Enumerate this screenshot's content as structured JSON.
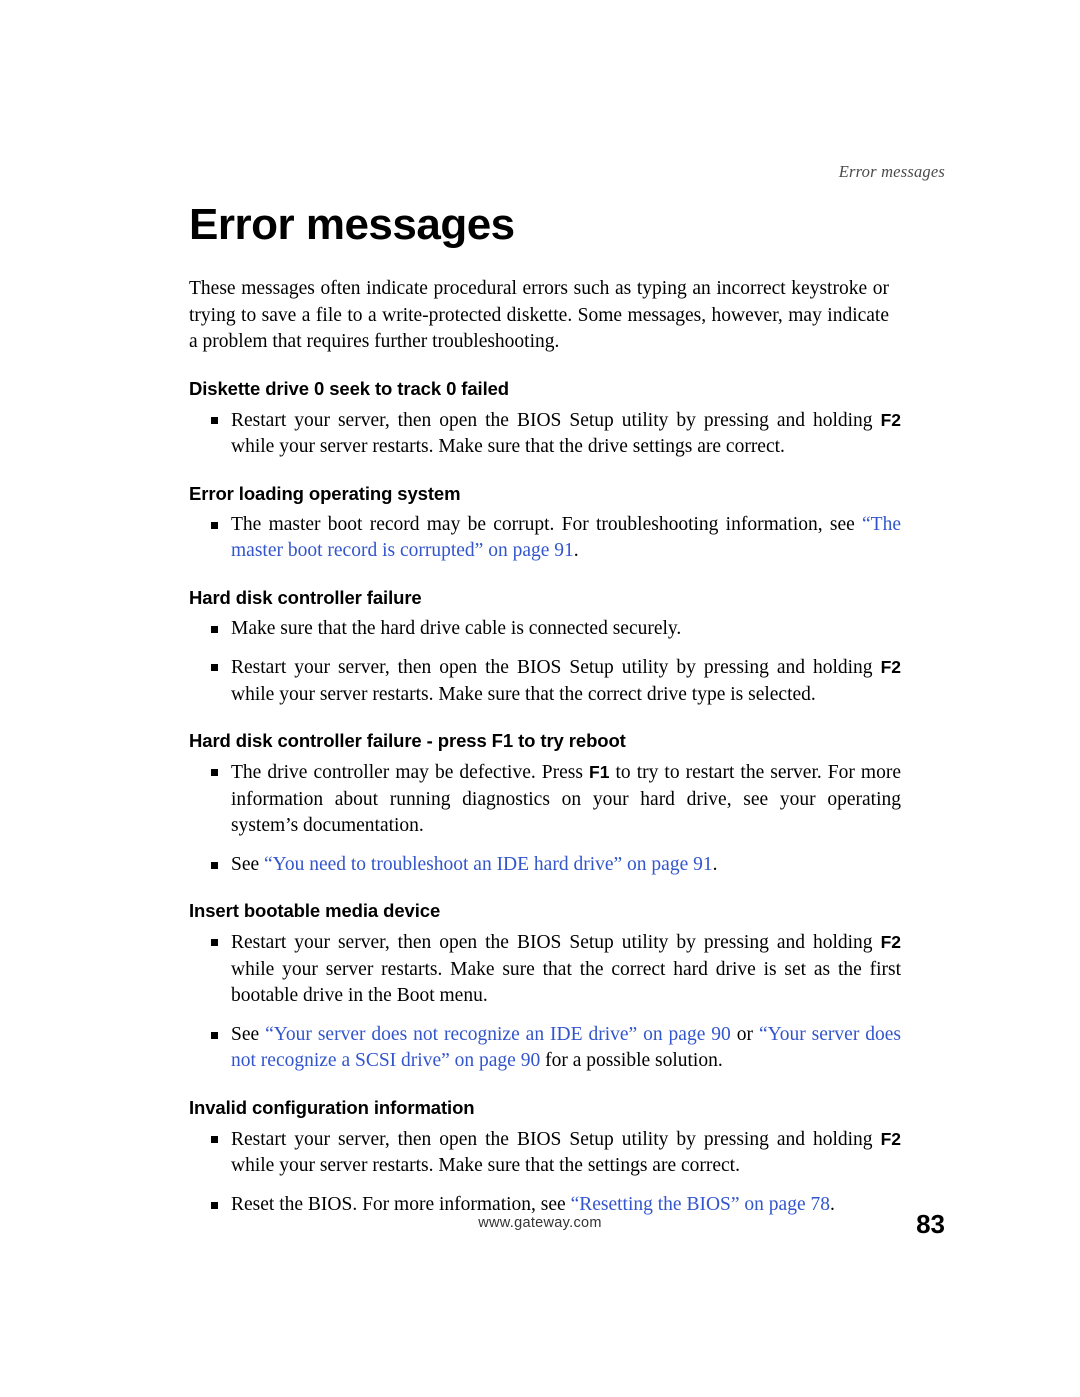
{
  "header": {
    "running_head": "Error messages"
  },
  "title": "Error messages",
  "intro": "These messages often indicate procedural errors such as typing an incorrect keystroke or trying to save a file to a write-protected diskette. Some messages, however, may indicate a problem that requires further troubleshooting.",
  "sections": [
    {
      "heading": "Diskette drive 0 seek to track 0 failed",
      "bullets": [
        {
          "parts": [
            {
              "t": "Restart your server, then open the BIOS Setup utility by pressing and holding ",
              "s": "normal"
            },
            {
              "t": "F2",
              "s": "kb"
            },
            {
              "t": " while your server restarts. Make sure that the drive settings are correct.",
              "s": "normal"
            }
          ]
        }
      ]
    },
    {
      "heading": "Error loading operating system",
      "bullets": [
        {
          "parts": [
            {
              "t": "The master boot record may be corrupt. For troubleshooting information, see ",
              "s": "normal"
            },
            {
              "t": "“The master boot record is corrupted” on page 91",
              "s": "link"
            },
            {
              "t": ".",
              "s": "normal"
            }
          ]
        }
      ]
    },
    {
      "heading": "Hard disk controller failure",
      "bullets": [
        {
          "parts": [
            {
              "t": "Make sure that the hard drive cable is connected securely.",
              "s": "normal"
            }
          ]
        },
        {
          "parts": [
            {
              "t": "Restart your server, then open the BIOS Setup utility by pressing and holding ",
              "s": "normal"
            },
            {
              "t": "F2",
              "s": "kb"
            },
            {
              "t": " while your server restarts. Make sure that the correct drive type is selected.",
              "s": "normal"
            }
          ]
        }
      ]
    },
    {
      "heading": "Hard disk controller failure - press F1 to try reboot",
      "bullets": [
        {
          "parts": [
            {
              "t": "The drive controller may be defective. Press ",
              "s": "normal"
            },
            {
              "t": "F1",
              "s": "kb"
            },
            {
              "t": " to try to restart the server. For more information about running diagnostics on your hard drive, see your operating system’s documentation.",
              "s": "normal"
            }
          ]
        },
        {
          "parts": [
            {
              "t": "See ",
              "s": "normal"
            },
            {
              "t": "“You need to troubleshoot an IDE hard drive” on page 91",
              "s": "link"
            },
            {
              "t": ".",
              "s": "normal"
            }
          ]
        }
      ]
    },
    {
      "heading": "Insert bootable media device",
      "bullets": [
        {
          "parts": [
            {
              "t": "Restart your server, then open the BIOS Setup utility by pressing and holding ",
              "s": "normal"
            },
            {
              "t": "F2",
              "s": "kb"
            },
            {
              "t": " while your server restarts. Make sure that the correct hard drive is set as the first bootable drive in the Boot menu.",
              "s": "normal"
            }
          ]
        },
        {
          "parts": [
            {
              "t": "See ",
              "s": "normal"
            },
            {
              "t": "“Your server does not recognize an IDE drive” on page 90",
              "s": "link"
            },
            {
              "t": " or ",
              "s": "normal"
            },
            {
              "t": "“Your server does not recognize a SCSI drive” on page 90",
              "s": "link"
            },
            {
              "t": " for a possible solution.",
              "s": "normal"
            }
          ]
        }
      ]
    },
    {
      "heading": "Invalid configuration information",
      "bullets": [
        {
          "parts": [
            {
              "t": "Restart your server, then open the BIOS Setup utility by pressing and holding ",
              "s": "normal"
            },
            {
              "t": "F2",
              "s": "kb"
            },
            {
              "t": " while your server restarts. Make sure that the settings are correct.",
              "s": "normal"
            }
          ]
        },
        {
          "parts": [
            {
              "t": "Reset the BIOS. For more information, see ",
              "s": "normal"
            },
            {
              "t": "“Resetting the BIOS” on page 78",
              "s": "link"
            },
            {
              "t": ".",
              "s": "normal"
            }
          ]
        }
      ]
    }
  ],
  "footer": {
    "url": "www.gateway.com",
    "page_number": "83"
  },
  "colors": {
    "link": "#3355cc",
    "running_head": "#4a4a4a"
  }
}
